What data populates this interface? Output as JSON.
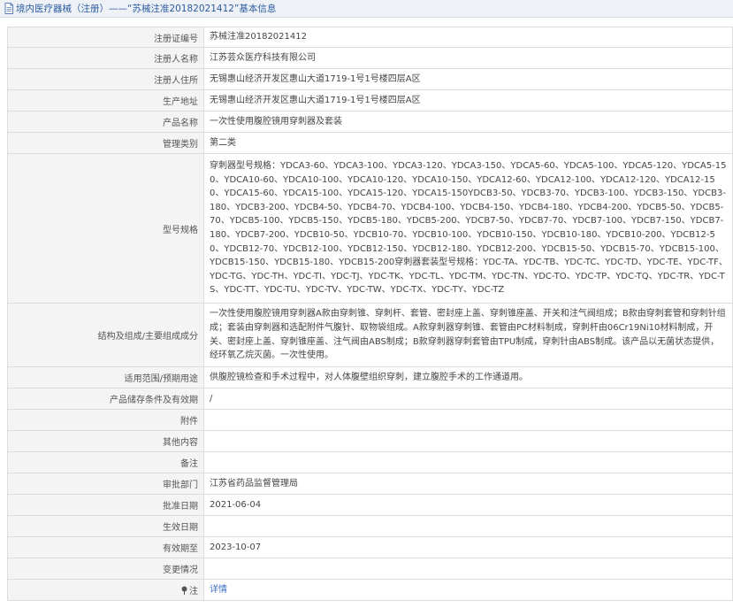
{
  "header": {
    "title": "境内医疗器械（注册）——“苏械注准20182021412”基本信息"
  },
  "rows": [
    {
      "label": "注册证编号",
      "value": "苏械注准20182021412"
    },
    {
      "label": "注册人名称",
      "value": "江苏芸众医疗科技有限公司"
    },
    {
      "label": "注册人住所",
      "value": "无锡惠山经济开发区惠山大道1719-1号1号楼四层A区"
    },
    {
      "label": "生产地址",
      "value": "无锡惠山经济开发区惠山大道1719-1号1号楼四层A区"
    },
    {
      "label": "产品名称",
      "value": "一次性使用腹腔镜用穿刺器及套装"
    },
    {
      "label": "管理类别",
      "value": "第二类"
    },
    {
      "label": "型号规格",
      "value": "穿刺器型号规格：YDCA3-60、YDCA3-100、YDCA3-120、YDCA3-150、YDCA5-60、YDCA5-100、YDCA5-120、YDCA5-150、YDCA10-60、YDCA10-100、YDCA10-120、YDCA10-150、YDCA12-60、YDCA12-100、YDCA12-120、YDCA12-150、YDCA15-60、YDCA15-100、YDCA15-120、YDCA15-150YDCB3-50、YDCB3-70、YDCB3-100、YDCB3-150、YDCB3-180、YDCB3-200、YDCB4-50、YDCB4-70、YDCB4-100、YDCB4-150、YDCB4-180、YDCB4-200、YDCB5-50、YDCB5-70、YDCB5-100、YDCB5-150、YDCB5-180、YDCB5-200、YDCB7-50、YDCB7-70、YDCB7-100、YDCB7-150、YDCB7-180、YDCB7-200、YDCB10-50、YDCB10-70、YDCB10-100、YDCB10-150、YDCB10-180、YDCB10-200、YDCB12-50、YDCB12-70、YDCB12-100、YDCB12-150、YDCB12-180、YDCB12-200、YDCB15-50、YDCB15-70、YDCB15-100、YDCB15-150、YDCB15-180、YDCB15-200穿刺器套装型号规格：YDC-TA、YDC-TB、YDC-TC、YDC-TD、YDC-TE、YDC-TF、YDC-TG、YDC-TH、YDC-TI、YDC-TJ、YDC-TK、YDC-TL、YDC-TM、YDC-TN、YDC-TO、YDC-TP、YDC-TQ、YDC-TR、YDC-TS、YDC-TT、YDC-TU、YDC-TV、YDC-TW、YDC-TX、YDC-TY、YDC-TZ"
    },
    {
      "label": "结构及组成/主要组成成分",
      "value": "一次性使用腹腔镜用穿刺器A款由穿刺锥、穿刺杆、套管、密封座上盖、穿刺锥座盖、开关和注气阀组成；B款由穿刺套管和穿刺针组成；套装由穿刺器和选配附件气腹针、取物袋组成。A款穿刺器穿刺锥、套管由PC材料制成，穿刺杆由06Cr19Ni10材料制成，开关、密封座上盖、穿刺锥座盖、注气阀由ABS制成；B款穿刺器穿刺套管由TPU制成，穿刺针由ABS制成。该产品以无菌状态提供，经环氧乙烷灭菌。一次性使用。"
    },
    {
      "label": "适用范围/预期用途",
      "value": "供腹腔镜检查和手术过程中，对人体腹壁组织穿刺，建立腹腔手术的工作通道用。"
    },
    {
      "label": "产品储存条件及有效期",
      "value": "/"
    },
    {
      "label": "附件",
      "value": ""
    },
    {
      "label": "其他内容",
      "value": ""
    },
    {
      "label": "备注",
      "value": ""
    },
    {
      "label": "审批部门",
      "value": "江苏省药品监督管理局"
    },
    {
      "label": "批准日期",
      "value": "2021-06-04"
    },
    {
      "label": "生效日期",
      "value": ""
    },
    {
      "label": "有效期至",
      "value": "2023-10-07"
    },
    {
      "label": "变更情况",
      "value": ""
    },
    {
      "label": "注",
      "value": "详情"
    }
  ]
}
